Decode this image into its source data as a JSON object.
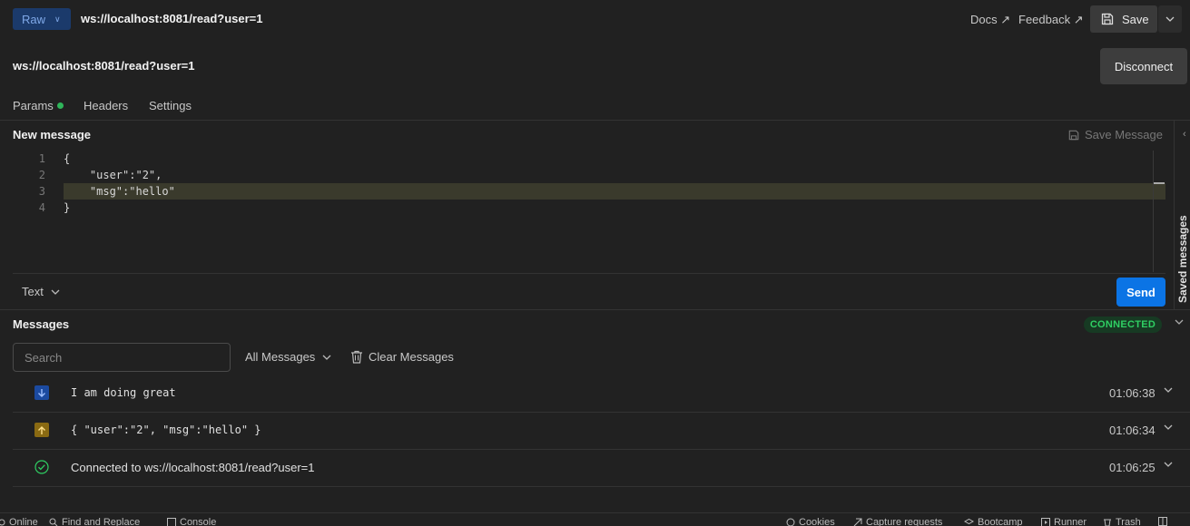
{
  "topbar": {
    "mode": "Raw",
    "url": "ws://localhost:8081/read?user=1",
    "docs": "Docs ↗",
    "feedback": "Feedback ↗",
    "save": "Save"
  },
  "request": {
    "url": "ws://localhost:8081/read?user=1",
    "disconnect": "Disconnect"
  },
  "tabs": {
    "params": "Params",
    "headers": "Headers",
    "settings": "Settings"
  },
  "new_message": {
    "title": "New message",
    "save_message": "Save Message",
    "lines": [
      {
        "num": "1",
        "code": "{"
      },
      {
        "num": "2",
        "code": "    \"user\":\"2\","
      },
      {
        "num": "3",
        "code": "    \"msg\":\"hello\""
      },
      {
        "num": "4",
        "code": "}"
      }
    ],
    "format": "Text",
    "send": "Send"
  },
  "side_panel": {
    "label": "Saved messages"
  },
  "messages": {
    "title": "Messages",
    "status": "CONNECTED",
    "search_placeholder": "Search",
    "filter": "All Messages",
    "clear": "Clear Messages",
    "items": [
      {
        "direction": "incoming",
        "text": "I am doing great",
        "time": "01:06:38"
      },
      {
        "direction": "outgoing",
        "text": "{ \"user\":\"2\", \"msg\":\"hello\" }",
        "time": "01:06:34"
      },
      {
        "direction": "connected",
        "text": "Connected to ws://localhost:8081/read?user=1",
        "time": "01:06:25"
      }
    ]
  },
  "status_bar": {
    "online": "Online",
    "find_replace": "Find and Replace",
    "console": "Console",
    "cookies": "Cookies",
    "capture": "Capture requests",
    "bootcamp": "Bootcamp",
    "runner": "Runner",
    "trash": "Trash"
  },
  "colors": {
    "accent": "#0b74e5",
    "connected": "#2fcf63",
    "incoming_icon": "#1b4aa0",
    "outgoing_icon": "#8a6a12"
  }
}
